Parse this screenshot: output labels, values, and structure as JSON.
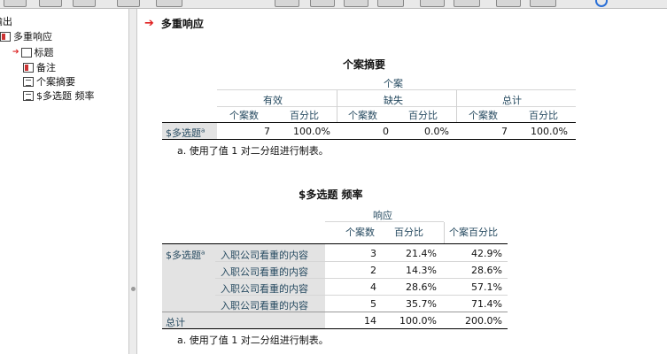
{
  "outline": {
    "root_label": "输出",
    "node_label": "多重响应",
    "children": [
      "标题",
      "备注",
      "个案摘要",
      "$多选题 频率"
    ]
  },
  "section": {
    "title": "多重响应"
  },
  "summary": {
    "title": "个案摘要",
    "group_header": "个案",
    "col_groups": [
      "有效",
      "缺失",
      "总计"
    ],
    "col_labels": [
      "个案数",
      "百分比",
      "个案数",
      "百分比",
      "个案数",
      "百分比"
    ],
    "row_label": "$多选题",
    "row_sup": "a",
    "values": [
      "7",
      "100.0%",
      "0",
      "0.0%",
      "7",
      "100.0%"
    ],
    "footnote": "a. 使用了值 1 对二分组进行制表。"
  },
  "freq": {
    "title": "$多选题 频率",
    "resp_header": "响应",
    "col_labels": [
      "个案数",
      "百分比",
      "个案百分比"
    ],
    "group_label": "$多选题",
    "group_sup": "a",
    "rows": [
      {
        "label": "入职公司看重的内容",
        "n": "3",
        "pct": "21.4%",
        "case_pct": "42.9%"
      },
      {
        "label": "入职公司看重的内容",
        "n": "2",
        "pct": "14.3%",
        "case_pct": "28.6%"
      },
      {
        "label": "入职公司看重的内容",
        "n": "4",
        "pct": "28.6%",
        "case_pct": "57.1%"
      },
      {
        "label": "入职公司看重的内容",
        "n": "5",
        "pct": "35.7%",
        "case_pct": "71.4%"
      }
    ],
    "total": {
      "label": "总计",
      "n": "14",
      "pct": "100.0%",
      "case_pct": "200.0%"
    },
    "footnote": "a. 使用了值 1 对二分组进行制表。"
  }
}
